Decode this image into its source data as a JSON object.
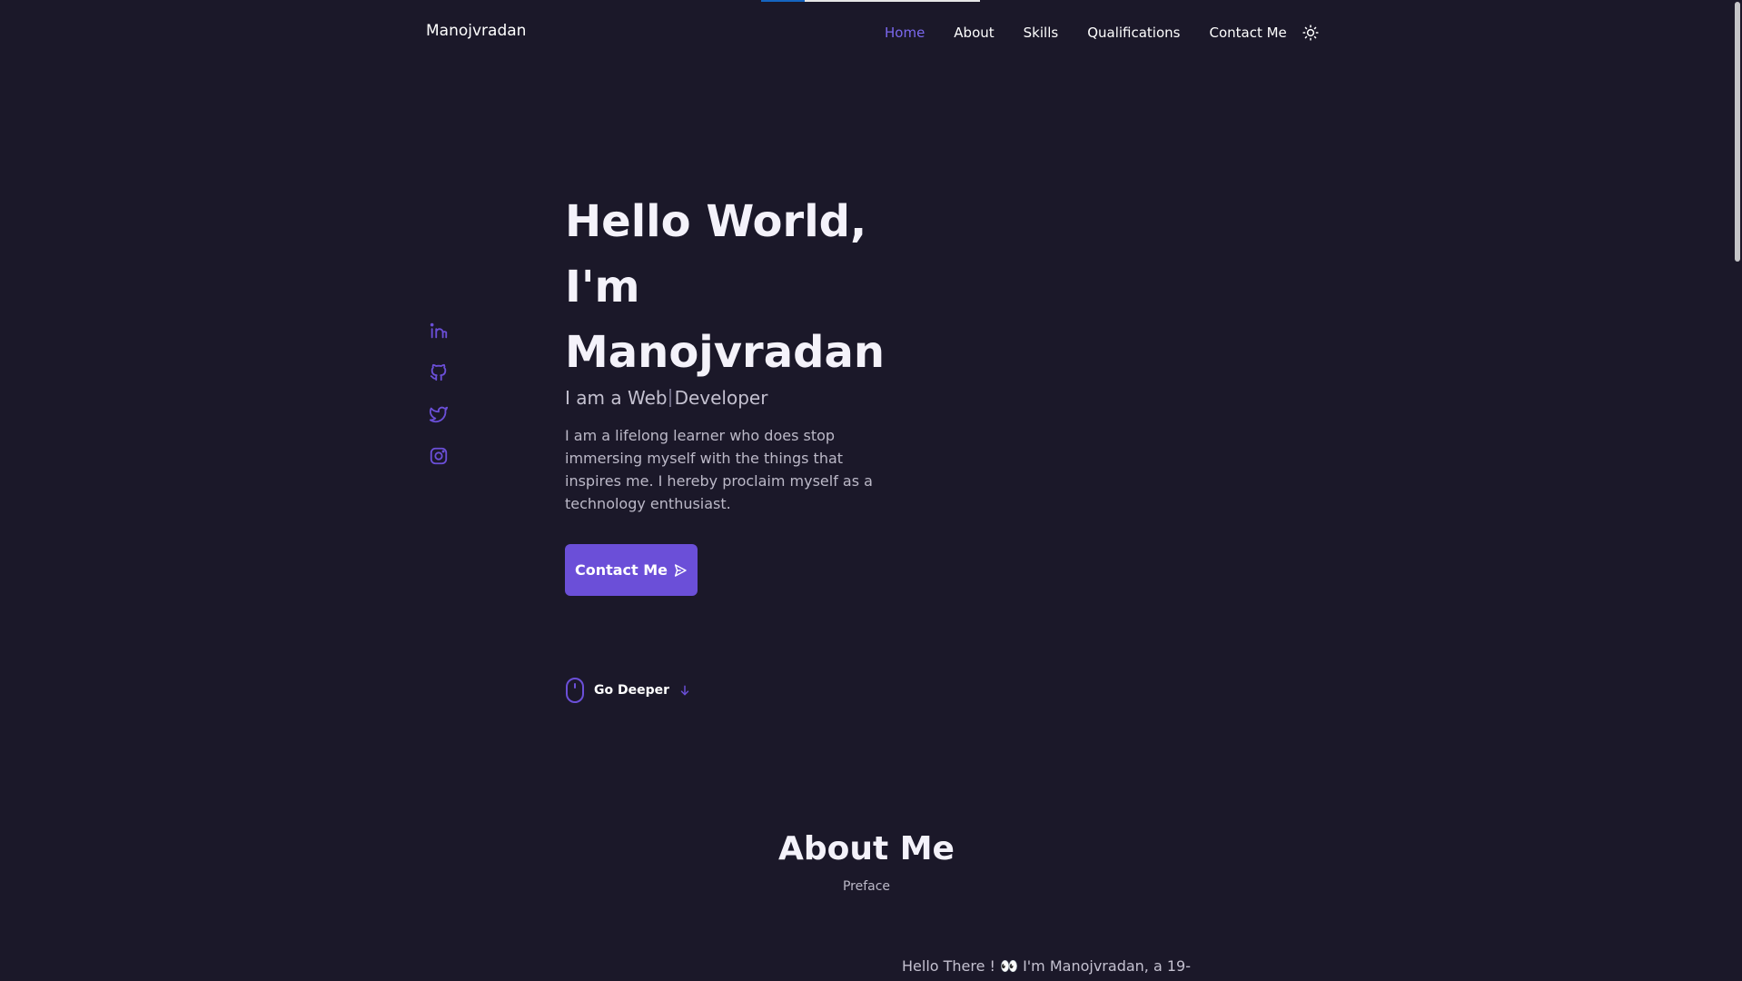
{
  "header": {
    "brand": "Manojvradan",
    "nav": [
      {
        "label": "Home",
        "active": true
      },
      {
        "label": "About"
      },
      {
        "label": "Skills"
      },
      {
        "label": "Qualifications"
      },
      {
        "label": "Contact Me"
      }
    ],
    "theme_icon": "sun-icon"
  },
  "loader": {
    "progress": 0.2
  },
  "social": [
    "linkedin-icon",
    "github-icon",
    "twitter-icon",
    "instagram-icon"
  ],
  "hero": {
    "title_line1": "Hello World,",
    "title_line2": "I'm",
    "title_line3": "Manojvradan",
    "subtitle_prefix": "I am a Web",
    "subtitle_suffix": "Developer",
    "description": "I am a lifelong learner who does stop immersing myself with the things that inspires me. I hereby proclaim myself as a technology enthusiast.",
    "contact_label": "Contact Me",
    "go_deeper_label": "Go Deeper"
  },
  "about": {
    "title": "About Me",
    "subtitle": "Preface",
    "intro_start": "Hello There ! 👀 I'm Manojvradan, a 19-"
  },
  "colors": {
    "background": "#1b1829",
    "accent": "#6b4fd8",
    "accent_text": "#7b68ee"
  }
}
